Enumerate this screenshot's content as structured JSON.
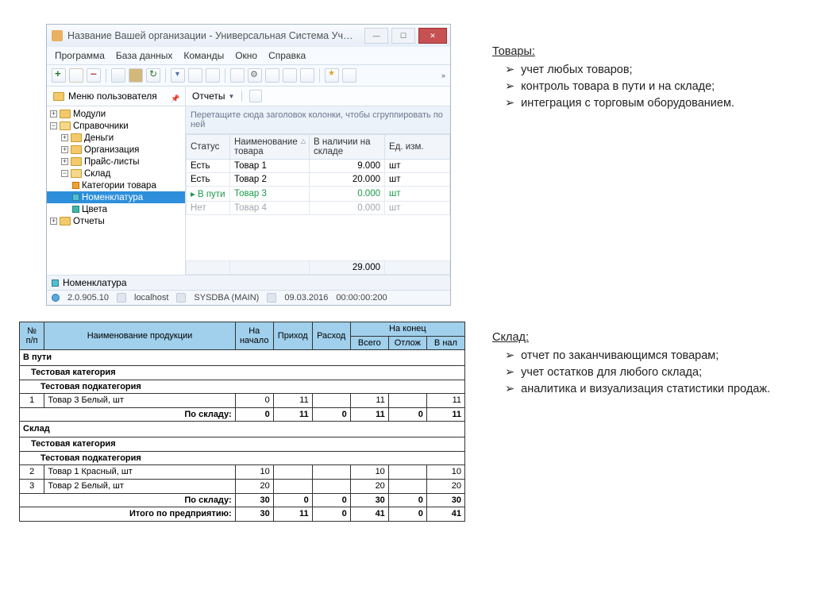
{
  "window": {
    "title": "Название Вашей организации - Универсальная Система Уч…",
    "min": "—",
    "max": "☐",
    "close": "✕"
  },
  "menu": {
    "program": "Программа",
    "db": "База данных",
    "cmd": "Команды",
    "win": "Окно",
    "help": "Справка"
  },
  "panel": {
    "usermenu": "Меню пользователя",
    "reports": "Отчеты"
  },
  "tree": {
    "modules": "Модули",
    "sprav": "Справочники",
    "money": "Деньги",
    "org": "Организация",
    "price": "Прайс-листы",
    "sklad": "Склад",
    "cat": "Категории товара",
    "nomen": "Номенклатура",
    "colors": "Цвета",
    "reports": "Отчеты"
  },
  "grid": {
    "grouphint": "Перетащите сюда заголовок колонки, чтобы сгруппировать по ней",
    "h_status": "Статус",
    "h_name": "Наименование товара",
    "h_stock": "В наличии на складе",
    "h_unit": "Ед. изм.",
    "rows": [
      {
        "status": "Есть",
        "name": "Товар 1",
        "stock": "9.000",
        "unit": "шт"
      },
      {
        "status": "Есть",
        "name": "Товар 2",
        "stock": "20.000",
        "unit": "шт"
      },
      {
        "status": "В пути",
        "name": "Товар 3",
        "stock": "0.000",
        "unit": "шт"
      },
      {
        "status": "Нет",
        "name": "Товар 4",
        "stock": "0.000",
        "unit": "шт"
      }
    ],
    "total": "29.000"
  },
  "tab": {
    "label": "Номенклатура"
  },
  "status": {
    "ver": "2.0.905.10",
    "host": "localhost",
    "user": "SYSDBA (MAIN)",
    "date": "09.03.2016",
    "time": "00:00:00:200"
  },
  "bullets1": {
    "head": "Товары:",
    "items": [
      "учет любых товаров;",
      "контроль товара в пути и на складе;",
      "интеграция с торговым оборудованием."
    ]
  },
  "bullets2": {
    "head": "Склад:",
    "items": [
      "отчет по заканчивающимся товарам;",
      "учет остатков для любого склада;",
      "аналитика и визуализация статистики продаж."
    ]
  },
  "report": {
    "head": {
      "np": "№ п/п",
      "name": "Наименование продукции",
      "nach": "На начало",
      "prih": "Приход",
      "rash": "Расход",
      "konets": "На конец",
      "vsego": "Всего",
      "otloz": "Отлож",
      "vnal": "В нал"
    },
    "sect1": "В пути",
    "cat": "Тестовая категория",
    "subcat": "Тестовая подкатегория",
    "r1": {
      "n": "1",
      "name": "Товар 3 Белый, шт",
      "nach": "0",
      "prih": "11",
      "rash": "",
      "vsego": "11",
      "otloz": "",
      "vnal": "11"
    },
    "sum1": {
      "label": "По складу:",
      "nach": "0",
      "prih": "11",
      "rash": "0",
      "vsego": "11",
      "otloz": "0",
      "vnal": "11"
    },
    "sect2": "Склад",
    "r2": {
      "n": "2",
      "name": "Товар 1 Красный, шт",
      "nach": "10",
      "prih": "",
      "rash": "",
      "vsego": "10",
      "otloz": "",
      "vnal": "10"
    },
    "r3": {
      "n": "3",
      "name": "Товар 2 Белый, шт",
      "nach": "20",
      "prih": "",
      "rash": "",
      "vsego": "20",
      "otloz": "",
      "vnal": "20"
    },
    "sum2": {
      "label": "По складу:",
      "nach": "30",
      "prih": "0",
      "rash": "0",
      "vsego": "30",
      "otloz": "0",
      "vnal": "30"
    },
    "grand": {
      "label": "Итого по предприятию:",
      "nach": "30",
      "prih": "11",
      "rash": "0",
      "vsego": "41",
      "otloz": "0",
      "vnal": "41"
    }
  }
}
